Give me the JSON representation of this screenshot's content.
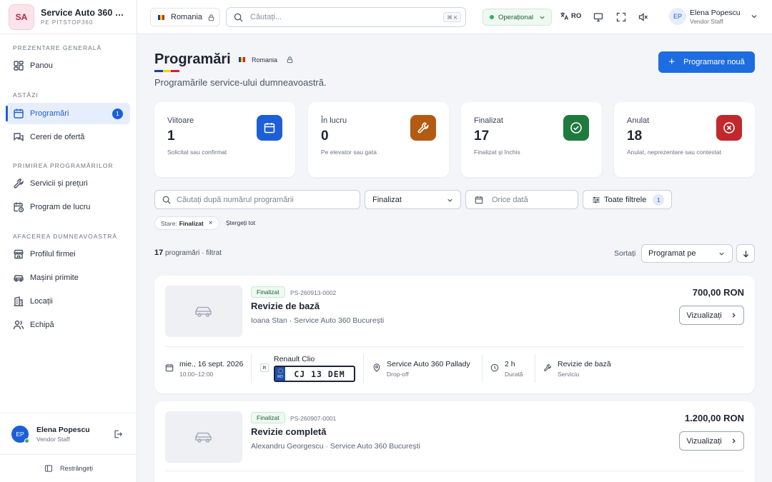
{
  "brand": {
    "logo": "SA",
    "name": "Service Auto 360 B...",
    "subtitle": "PE PITSTOP360"
  },
  "sidebar": {
    "sections": [
      {
        "title": "PREZENTARE GENERALĂ",
        "items": [
          {
            "label": "Panou",
            "icon": "dashboard-icon"
          }
        ]
      },
      {
        "title": "ASTĂZI",
        "items": [
          {
            "label": "Programări",
            "icon": "calendar-icon",
            "badge": "1",
            "active": true
          },
          {
            "label": "Cereri de ofertă",
            "icon": "chat-icon"
          }
        ]
      },
      {
        "title": "PRIMIREA PROGRAMĂRILOR",
        "items": [
          {
            "label": "Servicii și prețuri",
            "icon": "wrench-icon"
          },
          {
            "label": "Program de lucru",
            "icon": "clock-calendar-icon"
          }
        ]
      },
      {
        "title": "AFACEREA DUMNEAVOASTRĂ",
        "items": [
          {
            "label": "Profilul firmei",
            "icon": "store-icon"
          },
          {
            "label": "Mașini primite",
            "icon": "car-icon"
          },
          {
            "label": "Locații",
            "icon": "building-icon"
          },
          {
            "label": "Echipă",
            "icon": "team-icon"
          }
        ]
      }
    ],
    "user": {
      "initials": "EP",
      "name": "Elena Popescu",
      "role": "Vendor Staff"
    },
    "collapse_label": "Restrângeți"
  },
  "header": {
    "region": "Romania",
    "search_placeholder": "Căutați...",
    "shortcut": "⌘ K",
    "status": "Operațional",
    "language": "RO",
    "user": {
      "initials": "EP",
      "name": "Elena Popescu",
      "role": "Vendor Staff"
    }
  },
  "page": {
    "title": "Programări",
    "region": "Romania",
    "subtitle": "Programările service-ului dumneavoastră.",
    "new_button": "Programare nouă"
  },
  "stats": [
    {
      "label": "Viitoare",
      "value": "1",
      "desc": "Solicitat sau confirmat",
      "icon": "calendar-icon",
      "color": "#1d5fd6"
    },
    {
      "label": "În lucru",
      "value": "0",
      "desc": "Pe elevator sau gata",
      "icon": "wrench-icon",
      "color": "#b35a13"
    },
    {
      "label": "Finalizat",
      "value": "17",
      "desc": "Finalizat și închis",
      "icon": "check-circle-icon",
      "color": "#1f7a3e"
    },
    {
      "label": "Anulat",
      "value": "18",
      "desc": "Anulat, neprezentare sau contestat",
      "icon": "x-circle-icon",
      "color": "#c0282d"
    }
  ],
  "filters": {
    "search_placeholder": "Căutați după numărul programării",
    "status_value": "Finalizat",
    "date_placeholder": "Orice dată",
    "all_filters_label": "Toate filtrele",
    "all_filters_count": "1",
    "chip_label": "Stare:",
    "chip_value": "Finalizat",
    "clear_all": "Ștergeți tot"
  },
  "results": {
    "count": "17",
    "suffix": "programări · filtrat",
    "sort_label": "Sortați",
    "sort_value": "Programat pe"
  },
  "appointments": [
    {
      "status": "Finalizat",
      "code": "PS-260913-0002",
      "title": "Revizie de bază",
      "meta": "Ioana Stan · Service Auto 360 București",
      "price": "700,00 RON",
      "view_label": "Vizualizați",
      "date": "mie., 16 sept. 2026",
      "time": "10:00–12:00",
      "car": "Renault Clio",
      "plate": "CJ 13 DEM",
      "plate_tag": "R",
      "plate_country": "RO",
      "location": "Service Auto 360 Pallady",
      "location_sub": "Drop-off",
      "duration": "2 h",
      "duration_sub": "Durată",
      "service": "Revizie de bază",
      "service_sub": "Serviciu"
    },
    {
      "status": "Finalizat",
      "code": "PS-260907-0001",
      "title": "Revizie completă",
      "meta": "Alexandru Georgescu · Service Auto 360 București",
      "price": "1.200,00 RON",
      "view_label": "Vizualizați"
    }
  ],
  "colors": {
    "accent": "#1d6de0",
    "flag_blue": "#1c3f94",
    "flag_yellow": "#f5d20f",
    "flag_red": "#cc2230"
  }
}
